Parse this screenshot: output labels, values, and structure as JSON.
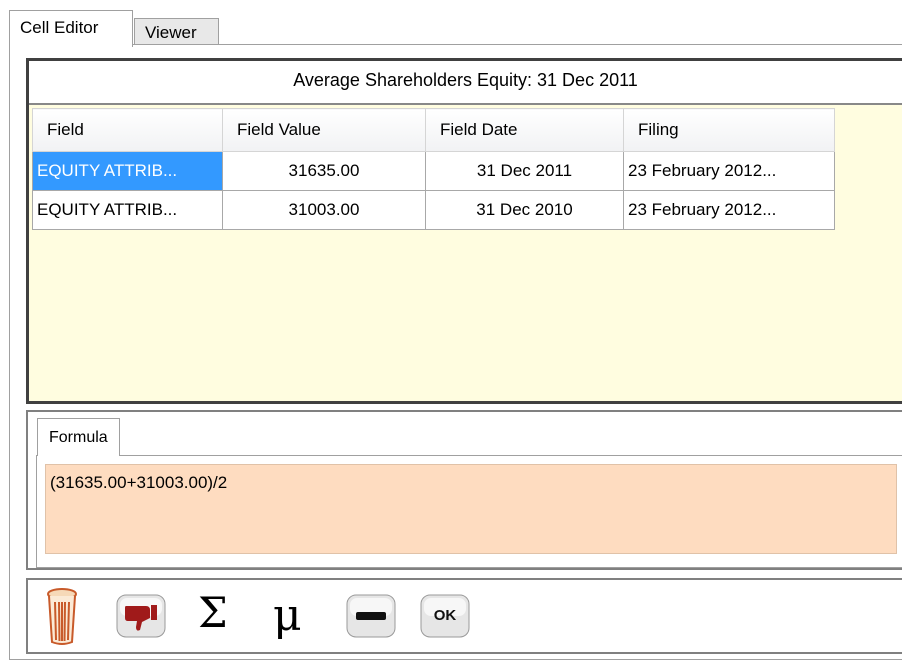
{
  "tabs": [
    {
      "label": "Cell Editor",
      "active": true
    },
    {
      "label": "Viewer",
      "active": false
    }
  ],
  "caption": "Average Shareholders Equity: 31 Dec 2011",
  "grid": {
    "columns": [
      "Field",
      "Field Value",
      "Field Date",
      "Filing"
    ],
    "rows": [
      {
        "field": "EQUITY ATTRIB...",
        "value": "31635.00",
        "date": "31 Dec 2011",
        "filing": "23 February 2012...",
        "selected": true
      },
      {
        "field": "EQUITY ATTRIB...",
        "value": "31003.00",
        "date": "31 Dec 2010",
        "filing": "23 February 2012...",
        "selected": false
      }
    ]
  },
  "formula": {
    "tab_label": "Formula",
    "value": "(31635.00+31003.00)/2"
  },
  "toolbar": {
    "items": [
      {
        "name": "trash-icon"
      },
      {
        "name": "thumbs-down-icon"
      },
      {
        "name": "sum-icon",
        "glyph": "Σ"
      },
      {
        "name": "mu-icon",
        "glyph": "μ"
      },
      {
        "name": "minus-icon"
      },
      {
        "name": "ok-button",
        "label": "OK"
      }
    ]
  },
  "colors": {
    "selection": "#3399ff",
    "grid_background": "#fffde0",
    "formula_background": "#fedcc0",
    "thumbs_down": "#a01a1a",
    "trash": "#c85a2a"
  }
}
